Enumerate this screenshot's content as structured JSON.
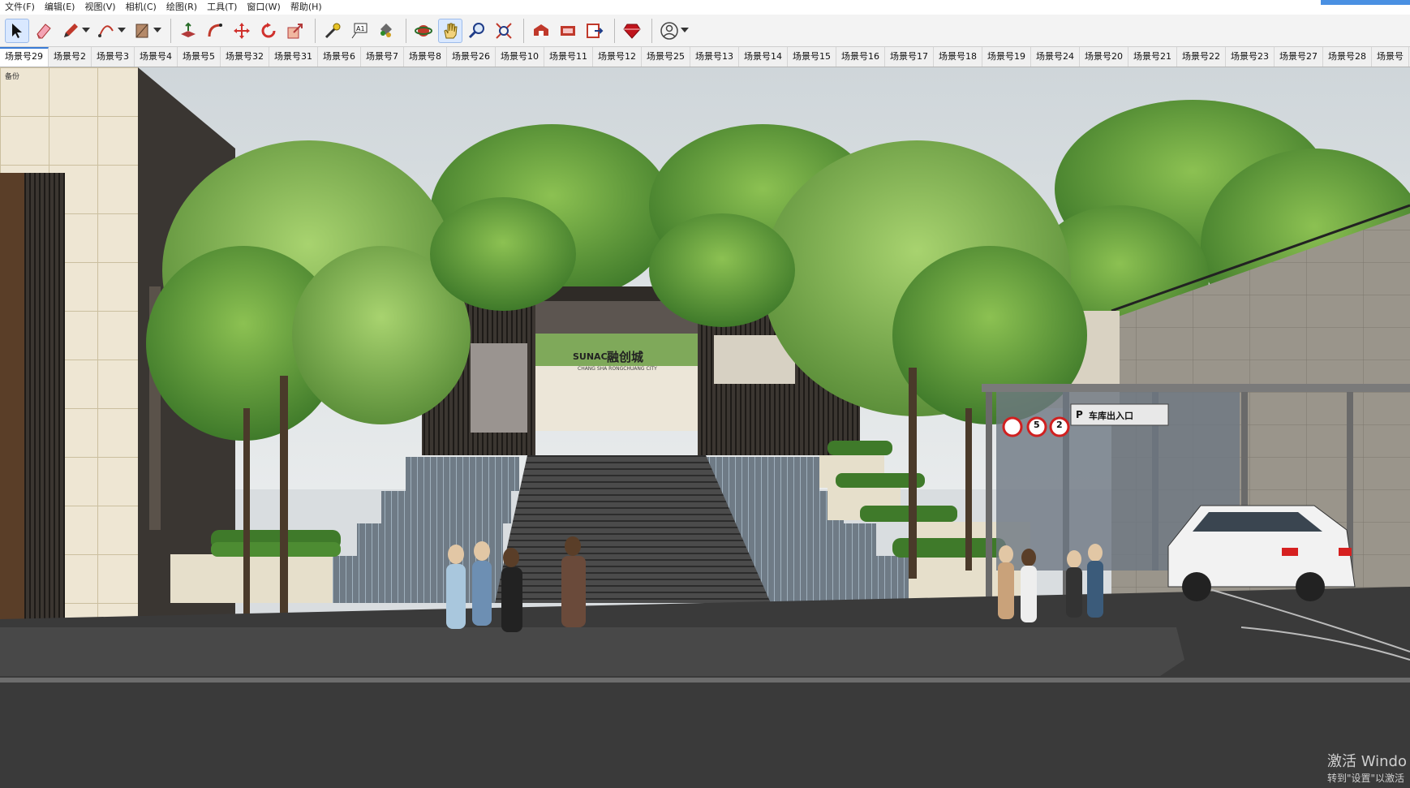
{
  "menu": [
    "文件(F)",
    "编辑(E)",
    "视图(V)",
    "相机(C)",
    "绘图(R)",
    "工具(T)",
    "窗口(W)",
    "帮助(H)"
  ],
  "toolbar": {
    "tools": [
      "select-tool",
      "eraser-tool",
      "pencil-tool",
      "arc-tool",
      "rectangle-tool",
      "push-pull-tool",
      "follow-me-tool",
      "move-tool",
      "rotate-tool",
      "scale-tool",
      "tape-measure-tool",
      "text-tool",
      "paint-bucket-tool",
      "orbit-tool",
      "pan-tool",
      "zoom-tool",
      "zoom-extents-tool",
      "warehouse-tool",
      "extension-warehouse-tool",
      "layout-tool",
      "ruby-tool",
      "account-tool"
    ]
  },
  "scene_tabs": [
    "场景号29",
    "场景号2",
    "场景号3",
    "场景号4",
    "场景号5",
    "场景号32",
    "场景号31",
    "场景号6",
    "场景号7",
    "场景号8",
    "场景号26",
    "场景号10",
    "场景号11",
    "场景号12",
    "场景号25",
    "场景号13",
    "场景号14",
    "场景号15",
    "场景号16",
    "场景号17",
    "场景号18",
    "场景号19",
    "场景号24",
    "场景号20",
    "场景号21",
    "场景号22",
    "场景号23",
    "场景号27",
    "场景号28",
    "场景号"
  ],
  "viewport": {
    "scene_corner_label": "备份",
    "entrance_brand": "SUNAC",
    "entrance_name": "融创城",
    "entrance_sub": "CHANG SHA RONGCHUANG CITY",
    "garage_sign": "车库出入口",
    "speed_limit": "5",
    "height_limit": "2",
    "parking_letter": "P"
  },
  "os_watermark": {
    "line1": "激活 Windo",
    "line2": "转到\"设置\"以激活"
  },
  "colors": {
    "sky": "#dfe3e6",
    "tree_green": "#5f9a3a",
    "road": "#3a3a3a",
    "wall": "#8f8b83",
    "stone": "#e7dfcc"
  }
}
